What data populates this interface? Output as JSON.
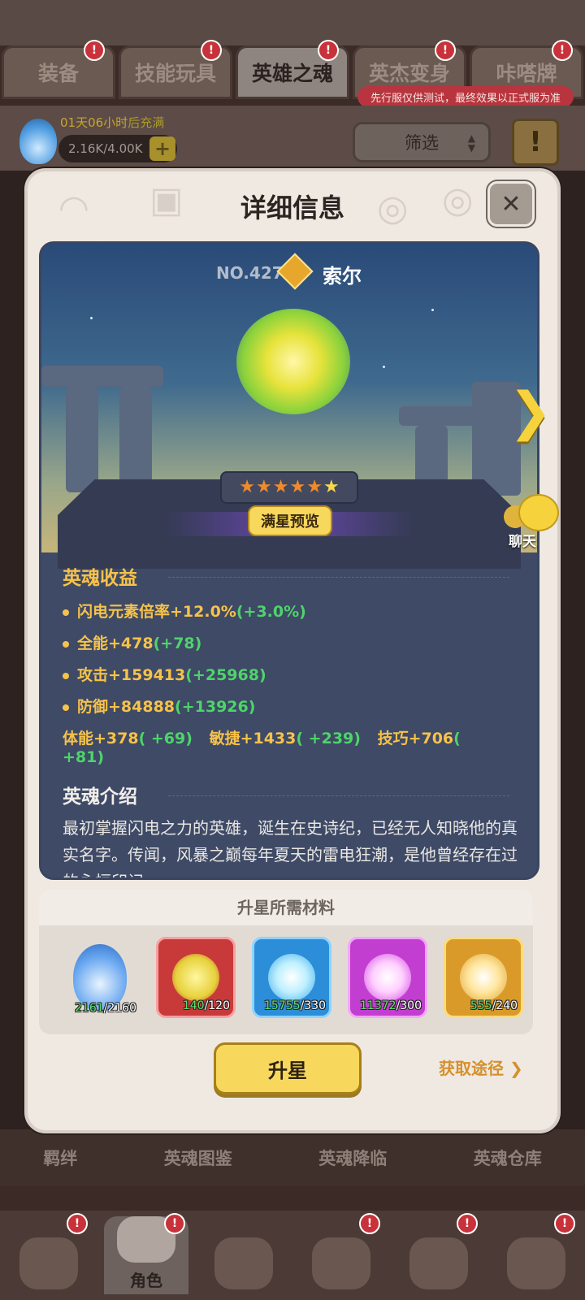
{
  "top_tabs": [
    {
      "label": "装备",
      "active": false
    },
    {
      "label": "技能玩具",
      "active": false
    },
    {
      "label": "英雄之魂",
      "active": true
    },
    {
      "label": "英杰变身",
      "active": false
    },
    {
      "label": "咔嗒牌",
      "active": false
    }
  ],
  "test_banner": "先行服仅供测试，最终效果以正式服为准",
  "resource": {
    "refill_time": "01天06小时",
    "refill_suffix": "后充满",
    "amount": "2.16K/4.00K",
    "plus_icon": "plus-icon"
  },
  "filter": {
    "label": "筛选"
  },
  "modal": {
    "title": "详细信息",
    "close_icon": "close-icon",
    "hero": {
      "number": "NO.427",
      "name": "索尔",
      "stars_total": 6,
      "preview_label": "满星预览"
    },
    "soul_bonus": {
      "title": "英魂收益",
      "stats": [
        {
          "label": "闪电元素倍率+12.0%",
          "bonus": "(+3.0%)"
        },
        {
          "label": "全能+478",
          "bonus": "(+78)"
        },
        {
          "label": "攻击+159413",
          "bonus": "(+25968)"
        },
        {
          "label": "防御+84888",
          "bonus": "(+13926)"
        }
      ],
      "sub_stats": [
        {
          "label": "体能+378",
          "bonus": "( +69)"
        },
        {
          "label": "敏捷+1433",
          "bonus": "( +239)"
        },
        {
          "label": "技巧+706",
          "bonus": "( +81)"
        }
      ]
    },
    "intro": {
      "title": "英魂介绍",
      "text": "最初掌握闪电之力的英雄，诞生在史诗纪，已经无人知晓他的真实名字。传闻，风暴之巅每年夏天的雷电狂潮，是他曾经存在过的永恒印记"
    },
    "materials": {
      "title": "升星所需材料",
      "items": [
        {
          "have": "2161",
          "need": "/2160",
          "color": "#6aa8f0"
        },
        {
          "have": "140",
          "need": "/120",
          "color": "#e7d13c"
        },
        {
          "have": "15755",
          "need": "/330",
          "color": "#bff0ff"
        },
        {
          "have": "11372",
          "need": "/300",
          "color": "#ffd0ff"
        },
        {
          "have": "555",
          "need": "/240",
          "color": "#ffe7a0"
        }
      ]
    },
    "upgrade_label": "升星",
    "obtain_label": "获取途径",
    "chat_label": "聊天"
  },
  "bottom_labels": [
    "羁绊",
    "英魂图鉴",
    "英魂降临",
    "英魂仓库"
  ],
  "bottom_nav": [
    {
      "label": "",
      "active": false
    },
    {
      "label": "角色",
      "active": true
    },
    {
      "label": "",
      "active": false
    },
    {
      "label": "",
      "active": false
    },
    {
      "label": "",
      "active": false
    },
    {
      "label": "",
      "active": false
    }
  ]
}
